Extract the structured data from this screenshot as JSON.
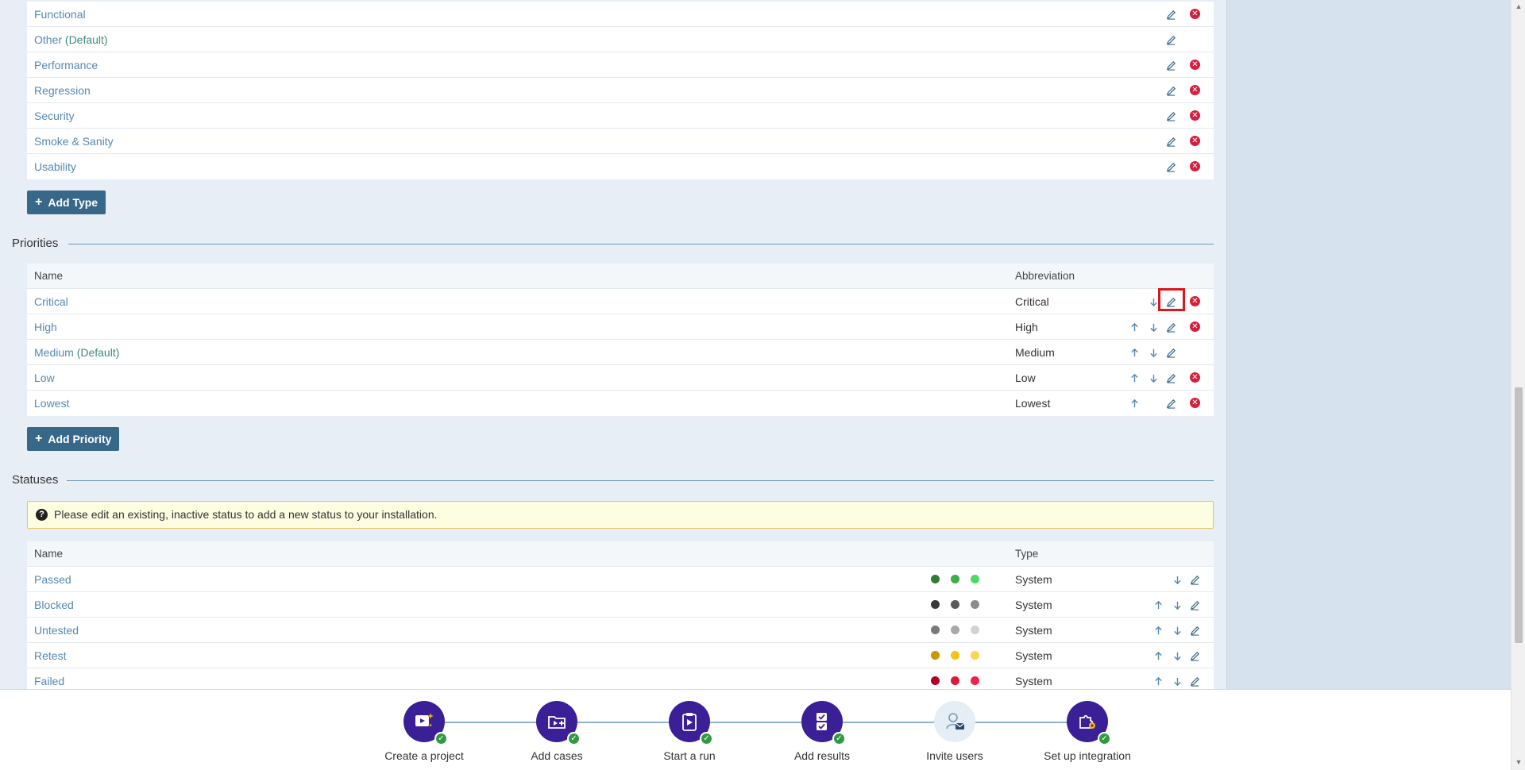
{
  "types": {
    "rows": [
      {
        "name": "Functional",
        "default": "",
        "deletable": true
      },
      {
        "name": "Other",
        "default": "(Default)",
        "deletable": false
      },
      {
        "name": "Performance",
        "default": "",
        "deletable": true
      },
      {
        "name": "Regression",
        "default": "",
        "deletable": true
      },
      {
        "name": "Security",
        "default": "",
        "deletable": true
      },
      {
        "name": "Smoke & Sanity",
        "default": "",
        "deletable": true
      },
      {
        "name": "Usability",
        "default": "",
        "deletable": true
      }
    ],
    "add_button": "Add Type"
  },
  "priorities": {
    "title": "Priorities",
    "columns": {
      "name": "Name",
      "abbreviation": "Abbreviation"
    },
    "rows": [
      {
        "name": "Critical",
        "default": "",
        "abbreviation": "Critical",
        "up": false,
        "down": true,
        "deletable": true
      },
      {
        "name": "High",
        "default": "",
        "abbreviation": "High",
        "up": true,
        "down": true,
        "deletable": true
      },
      {
        "name": "Medium",
        "default": "(Default)",
        "abbreviation": "Medium",
        "up": true,
        "down": true,
        "deletable": false
      },
      {
        "name": "Low",
        "default": "",
        "abbreviation": "Low",
        "up": true,
        "down": true,
        "deletable": true
      },
      {
        "name": "Lowest",
        "default": "",
        "abbreviation": "Lowest",
        "up": true,
        "down": false,
        "deletable": true
      }
    ],
    "add_button": "Add Priority"
  },
  "statuses": {
    "title": "Statuses",
    "info": "Please edit an existing, inactive status to add a new status to your installation.",
    "columns": {
      "name": "Name",
      "type": "Type"
    },
    "rows": [
      {
        "name": "Passed",
        "type": "System",
        "colors": [
          "#2e7d32",
          "#3caf46",
          "#4cd964"
        ],
        "up": false,
        "down": true
      },
      {
        "name": "Blocked",
        "type": "System",
        "colors": [
          "#3a3a3a",
          "#5a5a5a",
          "#8c8c8c"
        ],
        "up": true,
        "down": true
      },
      {
        "name": "Untested",
        "type": "System",
        "colors": [
          "#7a7a7a",
          "#a8a8a8",
          "#d2d2d2"
        ],
        "up": true,
        "down": true
      },
      {
        "name": "Retest",
        "type": "System",
        "colors": [
          "#c99700",
          "#f0c419",
          "#ffd54f"
        ],
        "up": true,
        "down": true
      },
      {
        "name": "Failed",
        "type": "System",
        "colors": [
          "#b0002a",
          "#d81b3a",
          "#f0224a"
        ],
        "up": true,
        "down": true
      }
    ]
  },
  "onboarding": {
    "steps": [
      {
        "label": "Create a project",
        "icon": "project-icon",
        "done": true
      },
      {
        "label": "Add cases",
        "icon": "add-cases-icon",
        "done": true
      },
      {
        "label": "Start a run",
        "icon": "start-run-icon",
        "done": true
      },
      {
        "label": "Add results",
        "icon": "add-results-icon",
        "done": true
      },
      {
        "label": "Invite users",
        "icon": "invite-users-icon",
        "done": false
      },
      {
        "label": "Set up integration",
        "icon": "integration-icon",
        "done": true
      }
    ]
  },
  "colors": {
    "accent": "#386889",
    "link": "#5588b3",
    "delete": "#d41f3d",
    "onboarding": "#3a1f96",
    "check": "#2f9a41",
    "highlight": "#e0151c"
  }
}
